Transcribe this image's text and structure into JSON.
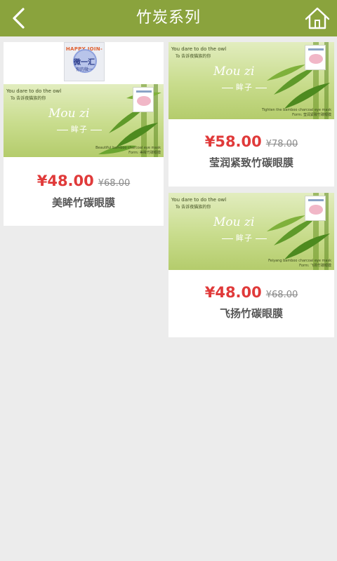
{
  "header": {
    "title": "竹炭系列",
    "background": "#8aa33d",
    "back_icon": "chevron-left-icon",
    "home_icon": "house-icon"
  },
  "logo": {
    "top_text": "HAPPY JOIN-US",
    "name": "微一汇",
    "subtitle": "你的微一"
  },
  "products": [
    {
      "name": "美眸竹碳眼膜",
      "price": "¥48.00",
      "original_price": "¥68.00",
      "banner": {
        "tagline_en": "You dare to do the owl",
        "tagline_cn": "To 告诉夜猫族的你",
        "brand_en": "Mou zi",
        "brand_cn": "眸子",
        "desc_en": "Beautiful bamboo charcoal eye mask",
        "desc_cn": "Form: 美眸竹碳眼膜"
      }
    },
    {
      "name": "莹润紧致竹碳眼膜",
      "price": "¥58.00",
      "original_price": "¥78.00",
      "banner": {
        "tagline_en": "You dare to do the owl",
        "tagline_cn": "To 告诉夜猫族的你",
        "brand_en": "Mou zi",
        "brand_cn": "眸子",
        "desc_en": "Tighten the bamboo charcoal eye mask",
        "desc_cn": "Form: 莹润紧致竹碳眼膜"
      }
    },
    {
      "name": "飞扬竹碳眼膜",
      "price": "¥48.00",
      "original_price": "¥68.00",
      "banner": {
        "tagline_en": "You dare to do the owl",
        "tagline_cn": "To 告诉夜猫族的你",
        "brand_en": "Mou zi",
        "brand_cn": "眸子",
        "desc_en": "Feiyang bamboo charcoal eye mask",
        "desc_cn": "Form: 飞扬竹碳眼膜"
      }
    }
  ],
  "colors": {
    "accent": "#8aa33d",
    "price": "#e03a3a",
    "background": "#ececec"
  }
}
